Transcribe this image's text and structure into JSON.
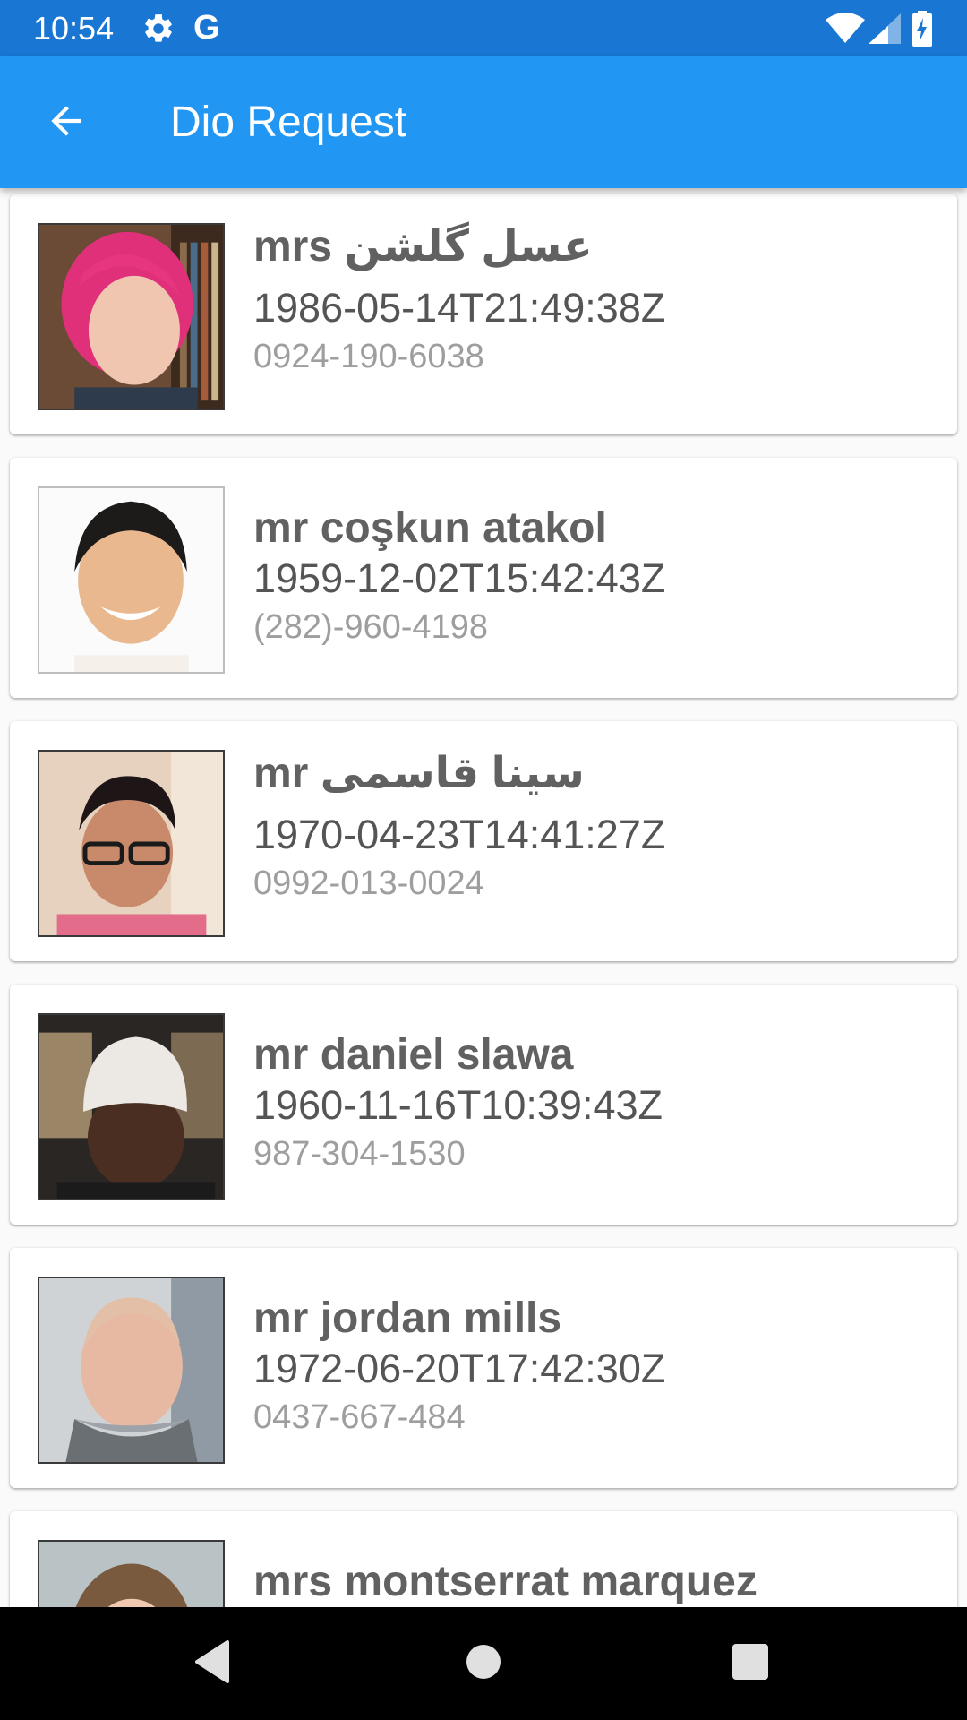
{
  "status_bar": {
    "time": "10:54",
    "g_label": "G",
    "icons": [
      "settings-gear-icon",
      "google-g-icon",
      "wifi-icon",
      "cell-signal-icon",
      "battery-charging-icon"
    ]
  },
  "app_bar": {
    "back_icon": "arrow-back-icon",
    "title": "Dio Request",
    "color": "#2196f3"
  },
  "users": [
    {
      "name": "mrs عسل گلشن",
      "dob": "1986-05-14T21:49:38Z",
      "phone": "0924-190-6038"
    },
    {
      "name": "mr coşkun atakol",
      "dob": "1959-12-02T15:42:43Z",
      "phone": "(282)-960-4198"
    },
    {
      "name": "mr سینا قاسمی",
      "dob": "1970-04-23T14:41:27Z",
      "phone": "0992-013-0024"
    },
    {
      "name": "mr daniel slawa",
      "dob": "1960-11-16T10:39:43Z",
      "phone": "987-304-1530"
    },
    {
      "name": "mr jordan mills",
      "dob": "1972-06-20T17:42:30Z",
      "phone": "0437-667-484"
    },
    {
      "name": "mrs montserrat marquez",
      "dob": "",
      "phone": ""
    }
  ],
  "nav_bar": {
    "icons": [
      "back-triangle-icon",
      "home-circle-icon",
      "recents-square-icon"
    ]
  }
}
